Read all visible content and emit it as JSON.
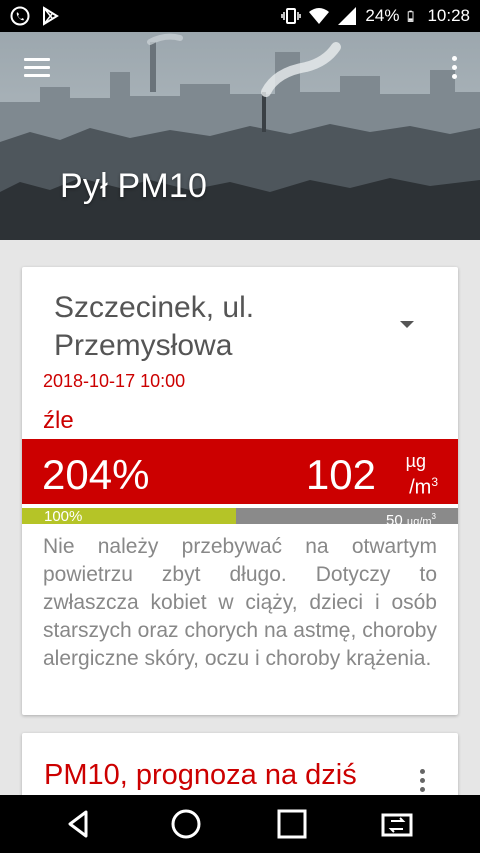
{
  "status_bar": {
    "battery": "24%",
    "time": "10:28",
    "icons": [
      "whatsapp-icon",
      "play-store-icon",
      "vibrate-icon",
      "wifi-icon",
      "signal-icon",
      "battery-icon"
    ]
  },
  "header": {
    "title": "Pył PM10",
    "icons": [
      "menu-icon",
      "overflow-menu-icon"
    ]
  },
  "measurement": {
    "station": "Szczecinek, ul. Przemysłowa",
    "timestamp": "2018-10-17 10:00",
    "quality": "źle",
    "percent": "204%",
    "concentration": "102",
    "unit_num": "µg",
    "unit_den": "/m",
    "unit_exp": "3",
    "bar_label": "100%",
    "bar_fill_fraction": 0.49,
    "norm_value": "50",
    "norm_unit": "µg/m",
    "norm_exp": "3",
    "advice": "Nie należy przebywać na otwartym powietrzu zbyt długo. Dotyczy to zwłaszcza kobiet w ciąży, dzieci i osób starszych oraz chorych na astmę, choroby alergiczne skóry, oczu i choroby krążenia.",
    "colors": {
      "alert": "#cc0000",
      "bar_fill": "#b5c427",
      "bar_track": "#8a8a8a"
    }
  },
  "forecast": {
    "title": "PM10, prognoza na dziś"
  },
  "nav": {
    "icons": [
      "back-icon",
      "home-icon",
      "recents-icon",
      "screen-switch-icon"
    ]
  }
}
